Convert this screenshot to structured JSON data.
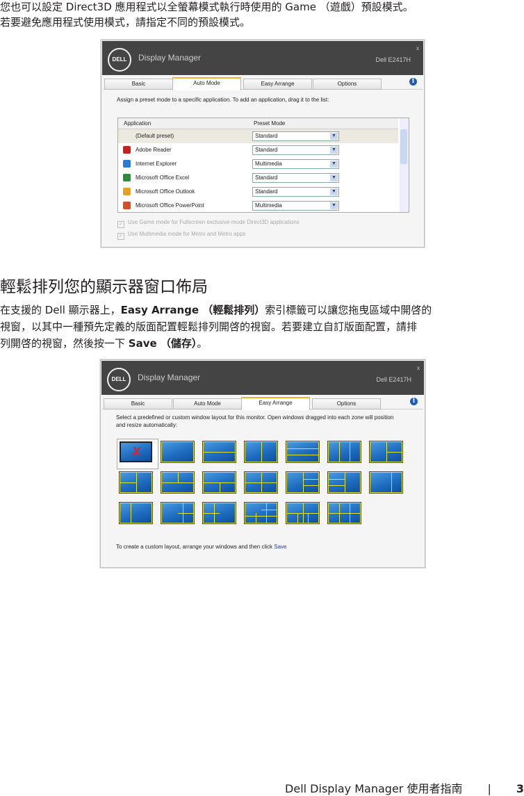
{
  "intro": [
    "您也可以設定 Direct3D 應用程式以全螢幕模式執行時使用的 Game （遊戲）預設模式。",
    "若要避免應用程式使用模式，請指定不同的預設模式。"
  ],
  "window": {
    "logo": "DELL",
    "title": "Display Manager",
    "model": "Dell E2417H",
    "close": "x",
    "tabs": [
      "Basic",
      "Auto Mode",
      "Easy Arrange",
      "Options"
    ]
  },
  "automode": {
    "instruction": "Assign a preset mode to a specific application.  To add an application, drag it to the list:",
    "columns": [
      "Application",
      "Preset Mode"
    ],
    "rows": [
      {
        "app": "(Default preset)",
        "mode": "Standard"
      },
      {
        "app": "Adobe Reader",
        "mode": "Standard",
        "color": "#c8201c"
      },
      {
        "app": "Internet Explorer",
        "mode": "Multimedia",
        "color": "#2a7ad8"
      },
      {
        "app": "Microsoft Office Excel",
        "mode": "Standard",
        "color": "#2e8b3a"
      },
      {
        "app": "Microsoft Office Outlook",
        "mode": "Standard",
        "color": "#e8a020"
      },
      {
        "app": "Microsoft Office PowerPoint",
        "mode": "Multimedia",
        "color": "#d0502a"
      }
    ],
    "checks": [
      "Use Game mode for Fullscreen exclusive-mode Direct3D applications",
      "Use Multimedia mode for Metro and Metro apps"
    ]
  },
  "section": {
    "heading": "輕鬆排列您的顯示器窗口佈局",
    "p1a": "在支援的 Dell 顯示器上，",
    "p1b": "Easy Arrange （輕鬆排列）",
    "p1c": "索引標籤可以讓您拖曳區域中開啓的",
    "p2": "視窗，以其中一種預先定義的版面配置輕鬆排列開啓的視窗。若要建立自訂版面配置，請排",
    "p3a": "列開啓的視窗，然後按一下 ",
    "p3b": "Save （儲存）",
    "p3c": "。"
  },
  "easyarrange": {
    "instruction": "Select a predefined or custom window layout for this monitor.  Open windows dragged into each zone will position and resize automatically:",
    "footer": "To create a custom layout, arrange your windows and then click ",
    "save_link": "Save",
    "layout_count": 20,
    "selected": 0
  },
  "footer": {
    "title": "Dell Display Manager 使用者指南",
    "sep": "|",
    "page": "3"
  }
}
